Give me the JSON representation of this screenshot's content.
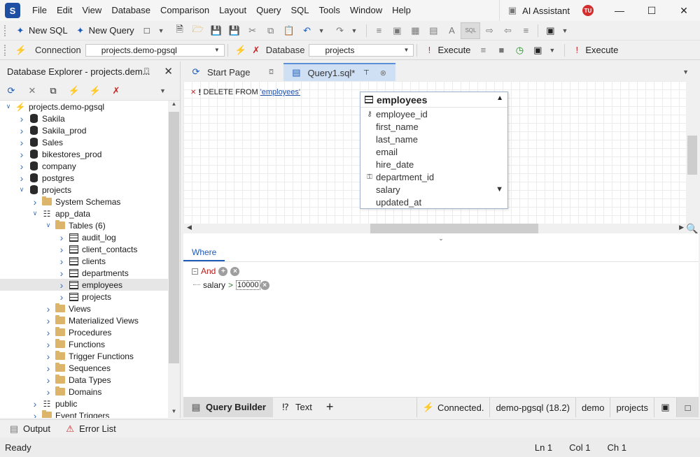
{
  "menu": [
    "File",
    "Edit",
    "View",
    "Database",
    "Comparison",
    "Layout",
    "Query",
    "SQL",
    "Tools",
    "Window",
    "Help"
  ],
  "ai_assistant": "AI Assistant",
  "avatar_initials": "TU",
  "toolbar": {
    "new_sql": "New SQL",
    "new_query": "New Query",
    "connection_label": "Connection",
    "connection_value": "projects.demo-pgsql",
    "database_label": "Database",
    "database_value": "projects",
    "execute": "Execute",
    "execute2": "Execute",
    "sql_btn": "SQL"
  },
  "explorer": {
    "title": "Database Explorer - projects.dem...",
    "tree": [
      {
        "label": "projects.demo-pgsql",
        "level": 0,
        "icon": "connection",
        "arrow": "down"
      },
      {
        "label": "Sakila",
        "level": 1,
        "icon": "db",
        "arrow": "right"
      },
      {
        "label": "Sakila_prod",
        "level": 1,
        "icon": "db",
        "arrow": "right"
      },
      {
        "label": "Sales",
        "level": 1,
        "icon": "db",
        "arrow": "right"
      },
      {
        "label": "bikestores_prod",
        "level": 1,
        "icon": "db",
        "arrow": "right"
      },
      {
        "label": "company",
        "level": 1,
        "icon": "db",
        "arrow": "right"
      },
      {
        "label": "postgres",
        "level": 1,
        "icon": "db",
        "arrow": "right"
      },
      {
        "label": "projects",
        "level": 1,
        "icon": "db",
        "arrow": "down"
      },
      {
        "label": "System Schemas",
        "level": 2,
        "icon": "folder",
        "arrow": "right"
      },
      {
        "label": "app_data",
        "level": 2,
        "icon": "schema",
        "arrow": "down"
      },
      {
        "label": "Tables (6)",
        "level": 3,
        "icon": "folder",
        "arrow": "down"
      },
      {
        "label": "audit_log",
        "level": 4,
        "icon": "table",
        "arrow": "right"
      },
      {
        "label": "client_contacts",
        "level": 4,
        "icon": "table",
        "arrow": "right"
      },
      {
        "label": "clients",
        "level": 4,
        "icon": "table",
        "arrow": "right"
      },
      {
        "label": "departments",
        "level": 4,
        "icon": "table",
        "arrow": "right"
      },
      {
        "label": "employees",
        "level": 4,
        "icon": "table",
        "arrow": "right",
        "selected": true
      },
      {
        "label": "projects",
        "level": 4,
        "icon": "table",
        "arrow": "right"
      },
      {
        "label": "Views",
        "level": 3,
        "icon": "folder",
        "arrow": "right"
      },
      {
        "label": "Materialized Views",
        "level": 3,
        "icon": "folder",
        "arrow": "right"
      },
      {
        "label": "Procedures",
        "level": 3,
        "icon": "folder",
        "arrow": "right"
      },
      {
        "label": "Functions",
        "level": 3,
        "icon": "folder",
        "arrow": "right"
      },
      {
        "label": "Trigger Functions",
        "level": 3,
        "icon": "folder",
        "arrow": "right"
      },
      {
        "label": "Sequences",
        "level": 3,
        "icon": "folder",
        "arrow": "right"
      },
      {
        "label": "Data Types",
        "level": 3,
        "icon": "folder",
        "arrow": "right"
      },
      {
        "label": "Domains",
        "level": 3,
        "icon": "folder",
        "arrow": "right"
      },
      {
        "label": "public",
        "level": 2,
        "icon": "schema",
        "arrow": "right"
      },
      {
        "label": "Event Triggers",
        "level": 2,
        "icon": "folder",
        "arrow": "right"
      }
    ]
  },
  "tabs": {
    "start_page": "Start Page",
    "query": "Query1.sql*"
  },
  "sql_text": {
    "prefix": "DELETE FROM",
    "table": "'employees'"
  },
  "entity": {
    "name": "employees",
    "fields": [
      {
        "name": "employee_id",
        "icon": "primary-key"
      },
      {
        "name": "first_name",
        "icon": ""
      },
      {
        "name": "last_name",
        "icon": ""
      },
      {
        "name": "email",
        "icon": ""
      },
      {
        "name": "hire_date",
        "icon": ""
      },
      {
        "name": "department_id",
        "icon": "foreign-key"
      },
      {
        "name": "salary",
        "icon": "",
        "filter": true
      },
      {
        "name": "updated_at",
        "icon": ""
      }
    ]
  },
  "where": {
    "tab": "Where",
    "group": "And",
    "condition": {
      "field": "salary",
      "operator": ">",
      "value": "10000"
    }
  },
  "bottom_tabs": {
    "query_builder": "Query Builder",
    "text": "Text",
    "add": "+"
  },
  "connection_status": {
    "state": "Connected.",
    "server": "demo-pgsql (18.2)",
    "user": "demo",
    "database": "projects"
  },
  "output": {
    "output": "Output",
    "error_list": "Error List"
  },
  "status": {
    "ready": "Ready",
    "ln": "Ln 1",
    "col": "Col 1",
    "ch": "Ch 1"
  }
}
